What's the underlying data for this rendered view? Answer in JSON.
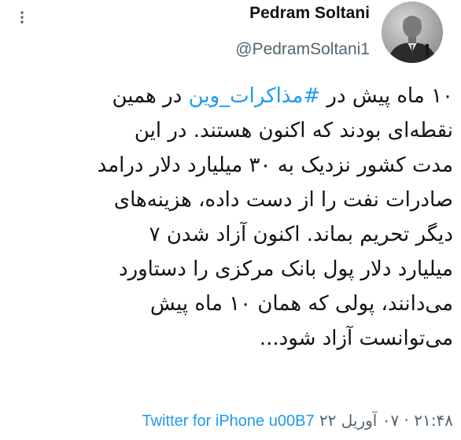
{
  "author": {
    "display_name": "Pedram Soltani",
    "handle": "@PedramSoltani1"
  },
  "tweet": {
    "hashtag": "#مذاکرات_وین",
    "lines": [
      "۱۰ ماه پیش در ",
      " در همین",
      "نقطه‌ای بودند که اکنون هستند. در این",
      "مدت کشور نزدیک به ۳۰ میلیارد دلار درامد",
      "صادرات نفت را از دست داده، هزینه‌های",
      "دیگر تحریم بماند. اکنون آزاد شدن ۷",
      "میلیارد دلار پول بانک مرکزی را دستاورد",
      "می‌دانند، پولی که همان ۱۰ ماه پیش",
      "می‌توانست آزاد شود..."
    ]
  },
  "footer": {
    "time_and_date": "۲۱:۴۸ · ۰۷ آوریل ۲۲",
    "source": "Twitter for iPhone u00B7"
  },
  "icons": {
    "more": "more-horizontal-icon",
    "avatar": "avatar-photo"
  },
  "colors": {
    "text": "#0f1419",
    "secondary": "#536471",
    "link": "#1d9bf0",
    "background": "#ffffff"
  }
}
